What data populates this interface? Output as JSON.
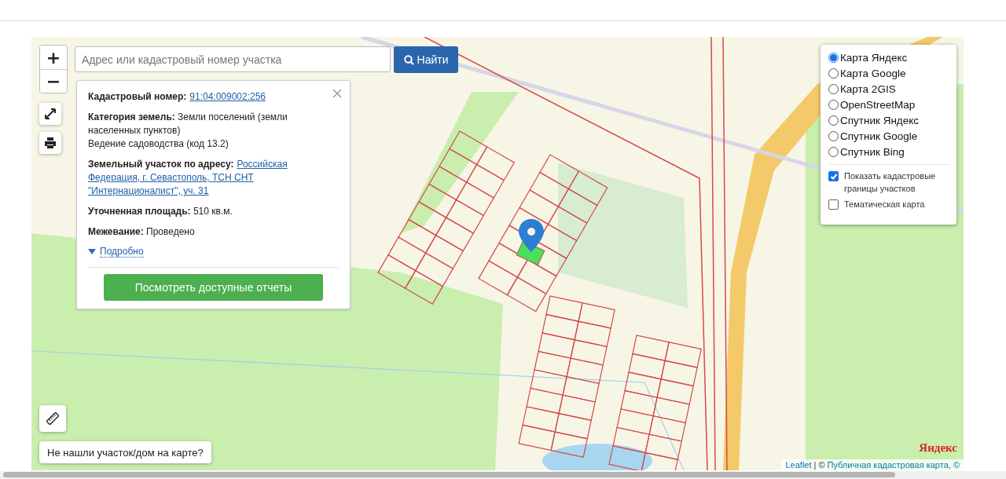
{
  "zoom_controls": [
    {
      "label": "+"
    },
    {
      "label": "−"
    }
  ],
  "search": {
    "placeholder": "Адрес или кадастровый номер участка",
    "button": "Найти"
  },
  "popup": {
    "fields": [
      {
        "kind": "link",
        "label": "Кадастровый номер:",
        "value_lines": [
          "91:04:009002:256"
        ]
      },
      {
        "kind": "text",
        "label": "Категория земель:",
        "value": "Земли поселений (земли населенных пунктов)",
        "extra": "Ведение садоводства (код 13.2)"
      },
      {
        "kind": "link",
        "label": "Земельный участок по адресу:",
        "value_lines": [
          "Российская",
          "Федерация, г. Севастополь, ТСН СНТ",
          "\"Интернационалист\", уч. 31"
        ]
      },
      {
        "kind": "text",
        "label": "Уточненная площадь:",
        "value": "510 кв.м."
      },
      {
        "kind": "text",
        "label": "Межевание:",
        "value": "Проведено"
      }
    ],
    "details_link": "Подробно",
    "button": "Посмотреть доступные отчеты"
  },
  "layers": {
    "base": [
      {
        "label": "Карта Яндекс",
        "selected": true
      },
      {
        "label": "Карта Google",
        "selected": false
      },
      {
        "label": "Карта 2GIS",
        "selected": false
      },
      {
        "label": "OpenStreetMap",
        "selected": false
      },
      {
        "label": "Спутник Яндекс",
        "selected": false
      },
      {
        "label": "Спутник Google",
        "selected": false
      },
      {
        "label": "Спутник Bing",
        "selected": false
      }
    ],
    "overlays": [
      {
        "label": "Показать кадастровые границы участков",
        "checked": true
      },
      {
        "label": "Тематическая карта",
        "checked": false
      }
    ]
  },
  "not_found_button": "Не нашли участок/дом на карте?",
  "map_logo": "Яндекс",
  "attribution": {
    "leaflet": "Leaflet",
    "separator": "| ©",
    "source": "Публичная кадастровая карта, ©"
  }
}
